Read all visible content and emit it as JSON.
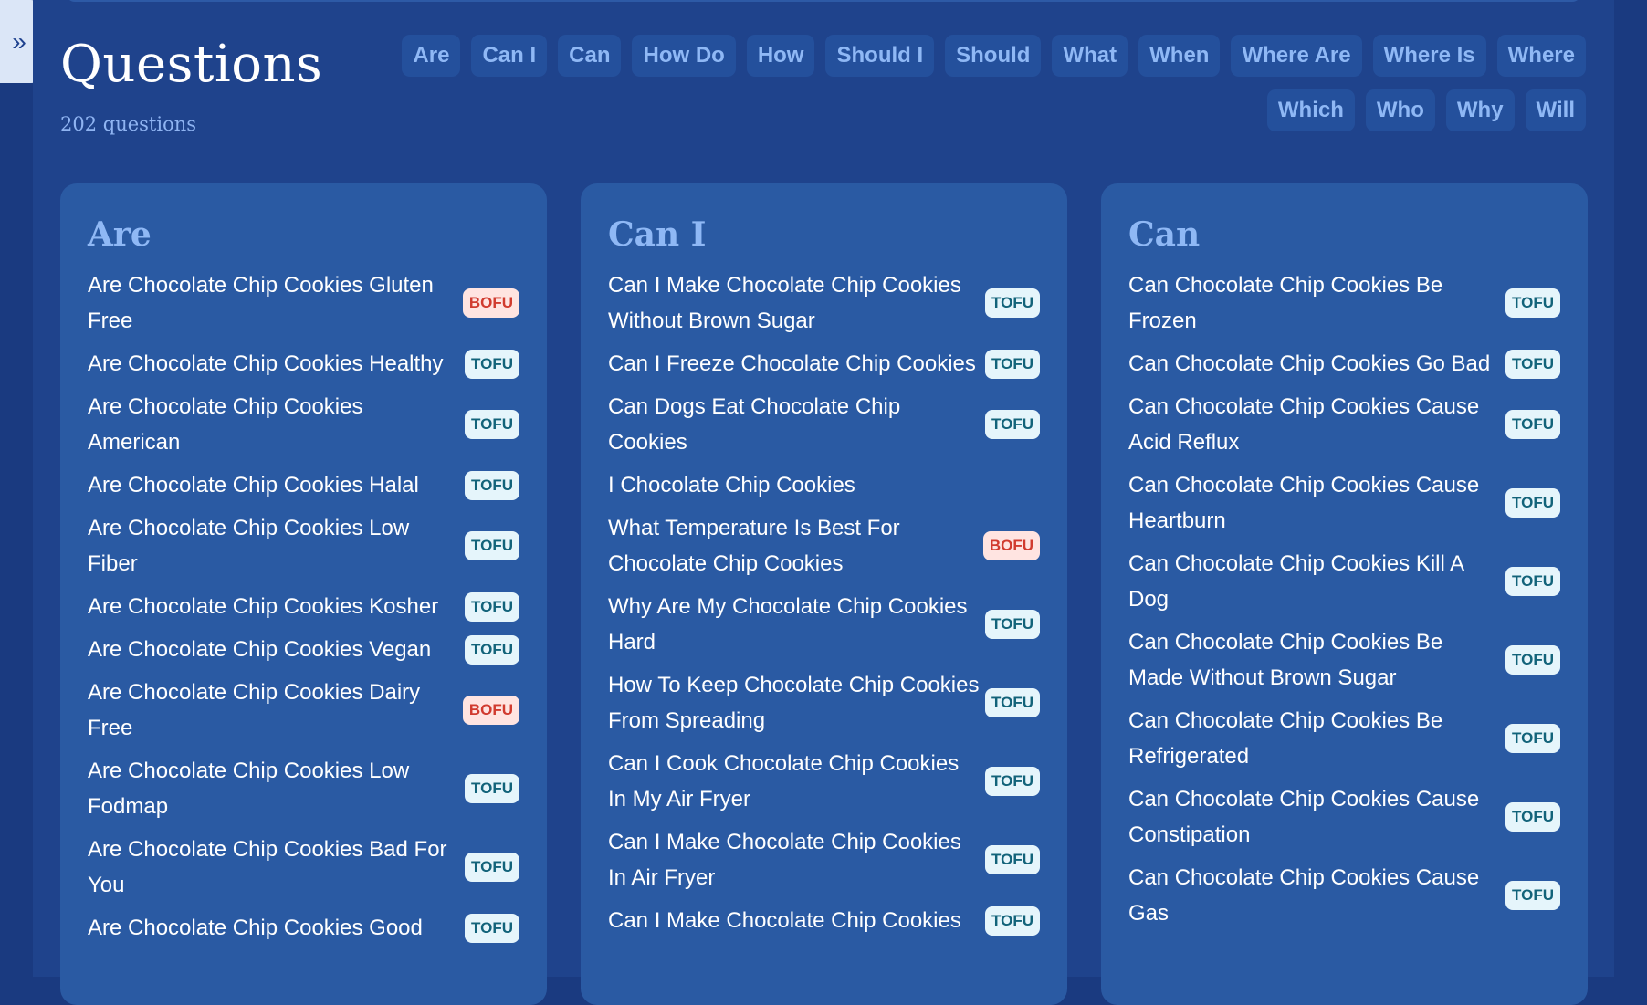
{
  "page": {
    "title": "Questions",
    "count": "202 questions",
    "expand_icon": "»"
  },
  "filters": [
    "Are",
    "Can I",
    "Can",
    "How Do",
    "How",
    "Should I",
    "Should",
    "What",
    "When",
    "Where Are",
    "Where Is",
    "Where",
    "Which",
    "Who",
    "Why",
    "Will"
  ],
  "colors": {
    "background": "#1f438c",
    "card": "#2a5aa3",
    "accent": "#8fb8f5",
    "tofu_bg": "#e5f5fb",
    "tofu_text": "#12637a",
    "bofu_bg": "#ffe4e1",
    "bofu_text": "#d13b2f"
  },
  "groups": [
    {
      "title": "Are",
      "items": [
        {
          "text": "Are Chocolate Chip Cookies Gluten Free",
          "tag": "BOFU"
        },
        {
          "text": "Are Chocolate Chip Cookies Healthy",
          "tag": "TOFU"
        },
        {
          "text": "Are Chocolate Chip Cookies American",
          "tag": "TOFU"
        },
        {
          "text": "Are Chocolate Chip Cookies Halal",
          "tag": "TOFU"
        },
        {
          "text": "Are Chocolate Chip Cookies Low Fiber",
          "tag": "TOFU"
        },
        {
          "text": "Are Chocolate Chip Cookies Kosher",
          "tag": "TOFU"
        },
        {
          "text": "Are Chocolate Chip Cookies Vegan",
          "tag": "TOFU"
        },
        {
          "text": "Are Chocolate Chip Cookies Dairy Free",
          "tag": "BOFU"
        },
        {
          "text": "Are Chocolate Chip Cookies Low Fodmap",
          "tag": "TOFU"
        },
        {
          "text": "Are Chocolate Chip Cookies Bad For You",
          "tag": "TOFU"
        },
        {
          "text": "Are Chocolate Chip Cookies Good",
          "tag": "TOFU"
        }
      ]
    },
    {
      "title": "Can I",
      "items": [
        {
          "text": "Can I Make Chocolate Chip Cookies Without Brown Sugar",
          "tag": "TOFU"
        },
        {
          "text": "Can I Freeze Chocolate Chip Cookies",
          "tag": "TOFU"
        },
        {
          "text": "Can Dogs Eat Chocolate Chip Cookies",
          "tag": "TOFU"
        },
        {
          "text": "I Chocolate Chip Cookies",
          "tag": ""
        },
        {
          "text": "What Temperature Is Best For Chocolate Chip Cookies",
          "tag": "BOFU"
        },
        {
          "text": "Why Are My Chocolate Chip Cookies Hard",
          "tag": "TOFU"
        },
        {
          "text": "How To Keep Chocolate Chip Cookies From Spreading",
          "tag": "TOFU"
        },
        {
          "text": "Can I Cook Chocolate Chip Cookies In My Air Fryer",
          "tag": "TOFU"
        },
        {
          "text": "Can I Make Chocolate Chip Cookies In Air Fryer",
          "tag": "TOFU"
        },
        {
          "text": "Can I Make Chocolate Chip Cookies",
          "tag": "TOFU"
        }
      ]
    },
    {
      "title": "Can",
      "items": [
        {
          "text": "Can Chocolate Chip Cookies Be Frozen",
          "tag": "TOFU"
        },
        {
          "text": "Can Chocolate Chip Cookies Go Bad",
          "tag": "TOFU"
        },
        {
          "text": "Can Chocolate Chip Cookies Cause Acid Reflux",
          "tag": "TOFU"
        },
        {
          "text": "Can Chocolate Chip Cookies Cause Heartburn",
          "tag": "TOFU"
        },
        {
          "text": "Can Chocolate Chip Cookies Kill A Dog",
          "tag": "TOFU"
        },
        {
          "text": "Can Chocolate Chip Cookies Be Made Without Brown Sugar",
          "tag": "TOFU"
        },
        {
          "text": "Can Chocolate Chip Cookies Be Refrigerated",
          "tag": "TOFU"
        },
        {
          "text": "Can Chocolate Chip Cookies Cause Constipation",
          "tag": "TOFU"
        },
        {
          "text": "Can Chocolate Chip Cookies Cause Gas",
          "tag": "TOFU"
        }
      ]
    }
  ]
}
